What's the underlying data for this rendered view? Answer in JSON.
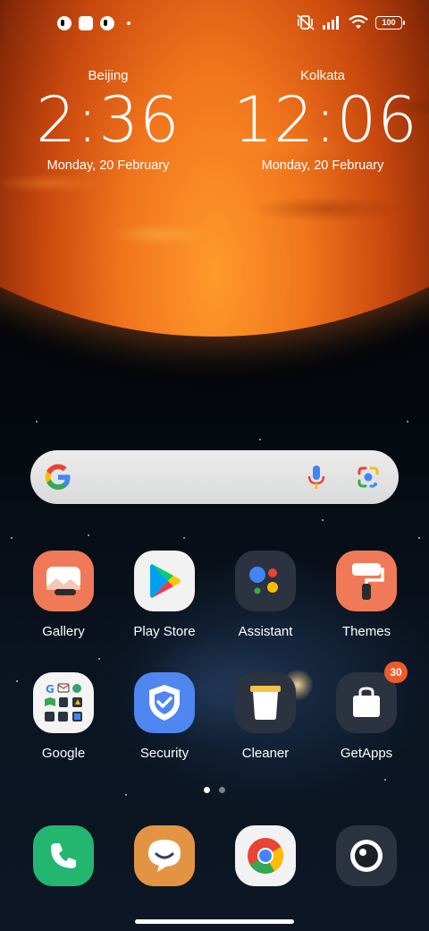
{
  "status_bar": {
    "battery": "100"
  },
  "clocks": [
    {
      "city": "Beijing",
      "time": "2:36",
      "date": "Monday, 20 February"
    },
    {
      "city": "Kolkata",
      "time": "12:06",
      "date": "Monday, 20 February"
    }
  ],
  "search": {
    "icons": [
      "google-g-icon",
      "microphone-icon",
      "google-lens-icon"
    ]
  },
  "apps": {
    "gallery": "Gallery",
    "play_store": "Play Store",
    "assistant": "Assistant",
    "themes": "Themes",
    "google": "Google",
    "security": "Security",
    "cleaner": "Cleaner",
    "getapps": "GetApps",
    "getapps_badge": "30"
  },
  "dock": [
    "phone-icon",
    "messages-icon",
    "chrome-icon",
    "camera-icon"
  ],
  "pager": {
    "pages": 2,
    "active": 1
  },
  "colors": {
    "gallery": "#f07a57",
    "themes": "#f07a57",
    "play_store": "#f2f2f2",
    "assistant": "#2b3240",
    "security": "#4f86f0",
    "cleaner": "#2b3240",
    "getapps": "#2b3240",
    "phone": "#23b66f",
    "messages": "#e39443",
    "badge": "#ef5a2a"
  }
}
